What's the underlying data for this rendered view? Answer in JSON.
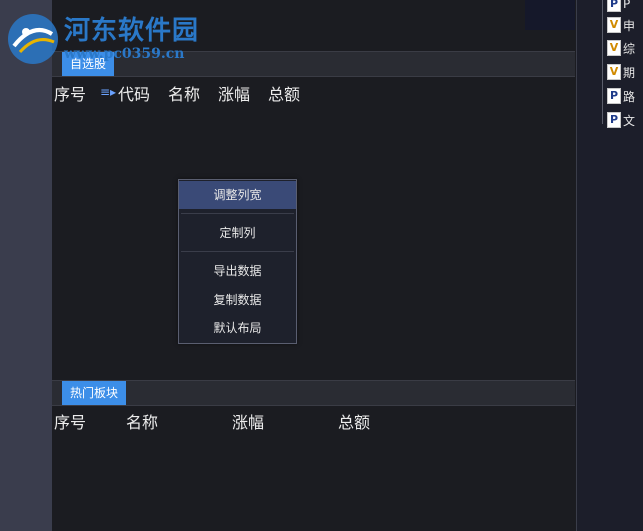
{
  "watermark": {
    "title": "河东软件园",
    "url": "www.pc0359.cn"
  },
  "right_panel": {
    "files": [
      {
        "type": "P",
        "label": "P"
      },
      {
        "type": "V",
        "label": "申"
      },
      {
        "type": "V",
        "label": "综"
      },
      {
        "type": "V",
        "label": "期"
      },
      {
        "type": "P",
        "label": "路"
      },
      {
        "type": "P",
        "label": "文"
      }
    ]
  },
  "watchlist": {
    "tab_label": "自选股",
    "columns": [
      "序号",
      "代码",
      "名称",
      "涨幅",
      "总额"
    ]
  },
  "context_menu": {
    "items": [
      {
        "label": "调整列宽"
      },
      {
        "label": "定制列"
      },
      {
        "label": "导出数据"
      },
      {
        "label": "复制数据"
      },
      {
        "label": "默认布局"
      }
    ]
  },
  "hot_sectors": {
    "tab_label": "热门板块",
    "columns": [
      "序号",
      "名称",
      "涨幅",
      "总额"
    ]
  },
  "colors": {
    "accent": "#3c8ee8",
    "background": "#1b1c21",
    "menu_highlight": "#3a4a77"
  }
}
